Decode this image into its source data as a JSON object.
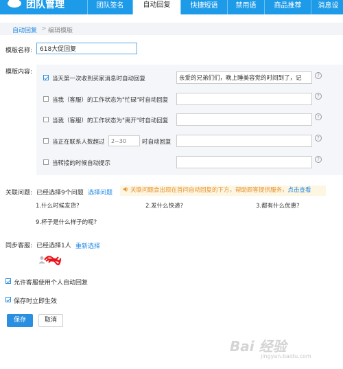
{
  "app": {
    "title": "团队管理"
  },
  "nav": {
    "tabs": [
      {
        "label": "团队签名"
      },
      {
        "label": "自动回复"
      },
      {
        "label": "快捷短语"
      },
      {
        "label": "禁用语"
      },
      {
        "label": "商品推荐"
      },
      {
        "label": "消息设"
      }
    ],
    "active_index": 1
  },
  "breadcrumb": {
    "parent": "自动回复",
    "separator": ">",
    "current": "编辑模版"
  },
  "form": {
    "name_label": "模版名称:",
    "name_value": "618大促回复",
    "content_label": "模版内容:",
    "rules": [
      {
        "text": "当天第一次收到买家消息时自动回复",
        "checked": true,
        "reply": "亲爱的兄弟们们，晚上睡美容觉的时间到了，记"
      },
      {
        "text": "当我（客服）的工作状态为\"忙碌\"时自动回复",
        "checked": false,
        "reply": ""
      },
      {
        "text": "当我（客服）的工作状态为\"离开\"时自动回复",
        "checked": false,
        "reply": ""
      },
      {
        "text_before": "当正在联系人数超过",
        "placeholder": "2~30",
        "text_after": "时自动回复",
        "checked": false,
        "reply": ""
      },
      {
        "text": "当转接的时候自动提示",
        "checked": false,
        "reply": ""
      }
    ],
    "help_icon": "?"
  },
  "related": {
    "label": "关联问题:",
    "count_text": "已经选择9个问题",
    "select_link": "选择问题",
    "notice": "关联问题会出现在首问自动回复的下方，帮助顾客提供服务，",
    "notice_link": "点击查看",
    "questions": [
      "1.什么时候发货?",
      "2.发什么快递?",
      "3.都有什么优惠?",
      "9.杯子是什么样子的呢?"
    ]
  },
  "sync": {
    "label": "同步客服:",
    "count_text": "已经选择1人",
    "reselect_link": "重新选择"
  },
  "options": {
    "allow_personal": "允许客服使用个人自动回复",
    "effective_on_save": "保存时立即生效",
    "allow_personal_checked": true,
    "effective_on_save_checked": true
  },
  "buttons": {
    "save": "保存",
    "cancel": "取消"
  },
  "watermark": {
    "main": "Bai 经验",
    "sub": "jingyan.baidu.com"
  },
  "colors": {
    "brand": "#1e9be8",
    "link": "#1e88e5",
    "notice_text": "#e6902b",
    "notice_bg": "#fdf6e3"
  }
}
